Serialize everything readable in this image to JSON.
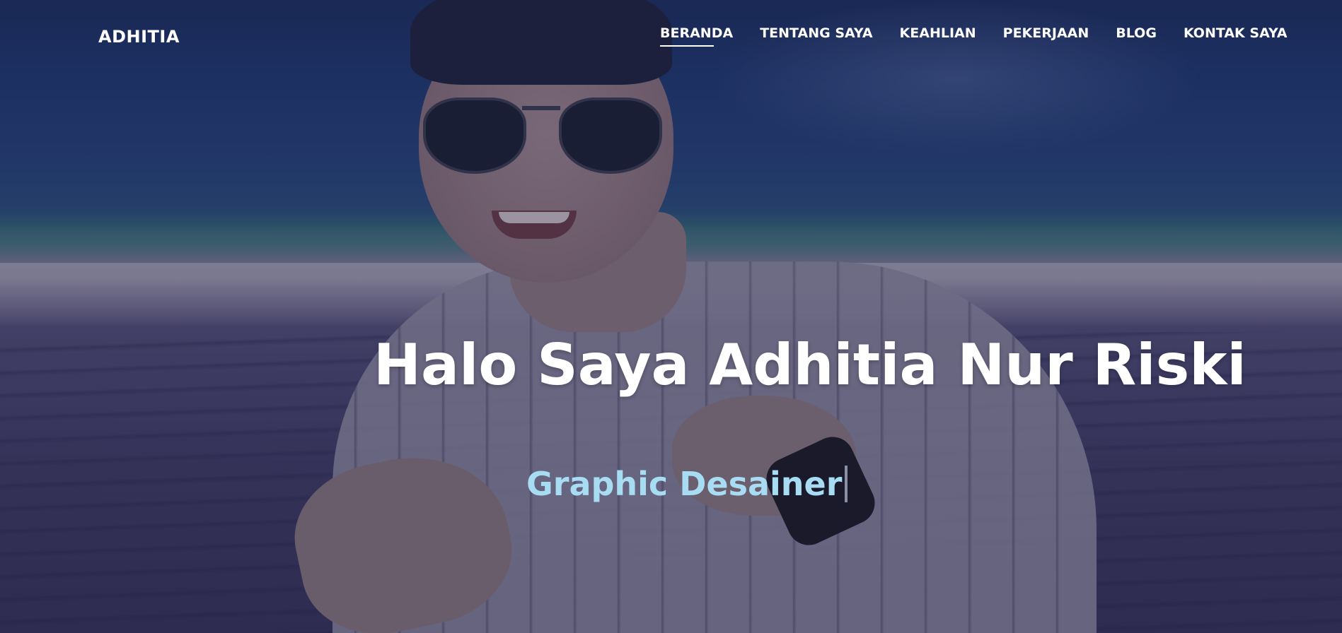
{
  "navbar": {
    "brand": "ADHITIA",
    "items": [
      {
        "label": "BERANDA",
        "active": true
      },
      {
        "label": "TENTANG SAYA",
        "active": false
      },
      {
        "label": "KEAHLIAN",
        "active": false
      },
      {
        "label": "PEKERJAAN",
        "active": false
      },
      {
        "label": "BLOG",
        "active": false
      },
      {
        "label": "KONTAK SAYA",
        "active": false
      }
    ]
  },
  "hero": {
    "title": "Halo Saya Adhitia Nur Riski",
    "typed_text": "Graphic Desainer"
  },
  "colors": {
    "nav_text": "#ffffff",
    "title_text": "#ffffff",
    "typed_text": "#a8dcf2",
    "overlay": "#141632"
  }
}
